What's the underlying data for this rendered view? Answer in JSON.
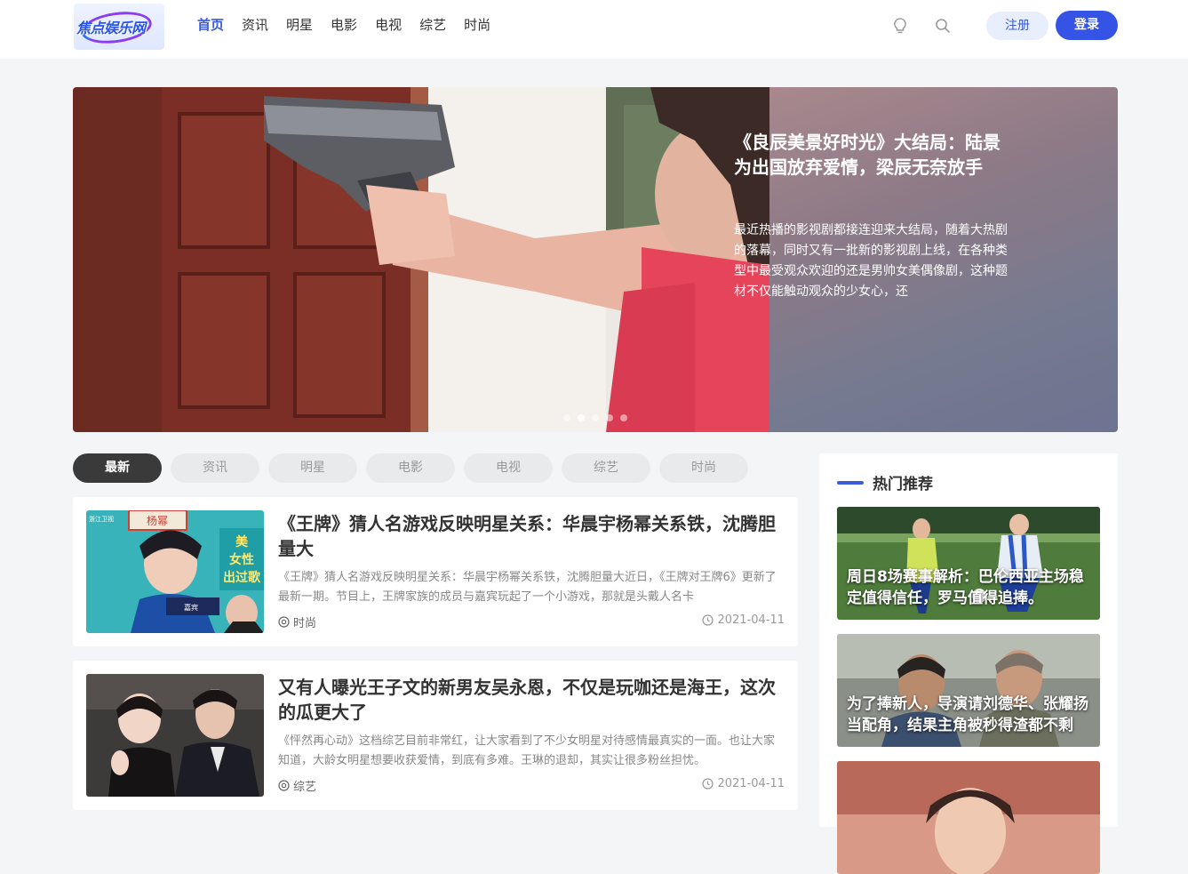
{
  "header": {
    "logo_text": "焦点娱乐网",
    "nav": [
      "首页",
      "资讯",
      "明星",
      "电影",
      "电视",
      "综艺",
      "时尚"
    ],
    "active_nav": "首页",
    "icons": [
      "bulb-icon",
      "search-icon"
    ],
    "register_label": "注册",
    "login_label": "登录"
  },
  "banner": {
    "title": "《良辰美景好时光》大结局：陆景为出国放弃爱情，梁辰无奈放手",
    "description": "最近热播的影视剧都接连迎来大结局，随着大热剧的落幕，同时又有一批新的影视剧上线，在各种类型中最受观众欢迎的还是男帅女美偶像剧，这种题材不仅能触动观众的少女心，还",
    "slide_count": 5,
    "active_slide": 2
  },
  "tabs": [
    "最新",
    "资讯",
    "明星",
    "电影",
    "电视",
    "综艺",
    "时尚"
  ],
  "active_tab": "最新",
  "articles": [
    {
      "title": "《王牌》猜人名游戏反映明星关系：华晨宇杨幂关系铁，沈腾胆量大",
      "description": "《王牌》猜人名游戏反映明星关系：华晨宇杨幂关系铁，沈腾胆量大近日，《王牌对王牌6》更新了最新一期。节目上，王牌家族的成员与嘉宾玩起了一个小游戏，那就是头戴人名卡",
      "category": "时尚",
      "date": "2021-04-11",
      "thumb_texts": [
        "杨幂",
        "美",
        "女性",
        "出过歌",
        "浙江卫视"
      ]
    },
    {
      "title": "又有人曝光王子文的新男友吴永恩，不仅是玩咖还是海王，这次的瓜更大了",
      "description": "《怦然再心动》这档综艺目前非常红，让大家看到了不少女明星对待感情最真实的一面。也让大家知道，大龄女明星想要收获爱情，到底有多难。王琳的退却，其实让很多粉丝担忧。",
      "category": "综艺",
      "date": "2021-04-11"
    }
  ],
  "sidebar": {
    "title": "热门推荐",
    "items": [
      "周日8场赛事解析：巴伦西亚主场稳定值得信任，罗马值得追捧。",
      "为了捧新人，导演请刘德华、张耀扬当配角，结果主角被秒得渣都不剩",
      ""
    ]
  }
}
